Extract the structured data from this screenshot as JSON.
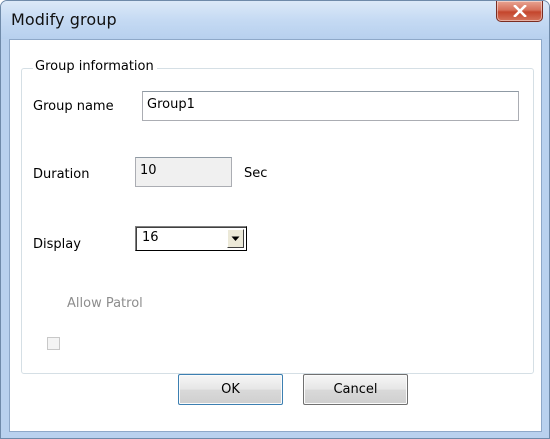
{
  "window": {
    "title": "Modify group",
    "close_label": "X"
  },
  "group_box": {
    "legend": "Group information"
  },
  "form": {
    "group_name_label": "Group name",
    "group_name_value": "Group1",
    "duration_label": "Duration",
    "duration_value": "10",
    "duration_unit": "Sec",
    "display_label": "Display",
    "display_value": "16",
    "allow_patrol_label": "Allow Patrol",
    "allow_patrol_checked": false,
    "allow_patrol_enabled": false
  },
  "buttons": {
    "ok_label": "OK",
    "cancel_label": "Cancel"
  },
  "icons": {
    "close": "close-icon",
    "dropdown": "chevron-down-icon"
  },
  "colors": {
    "title_bar": "#c5daf3",
    "close_button": "#c4452c",
    "client_bg": "#ffffff",
    "disabled_text": "#8d8d8d"
  }
}
